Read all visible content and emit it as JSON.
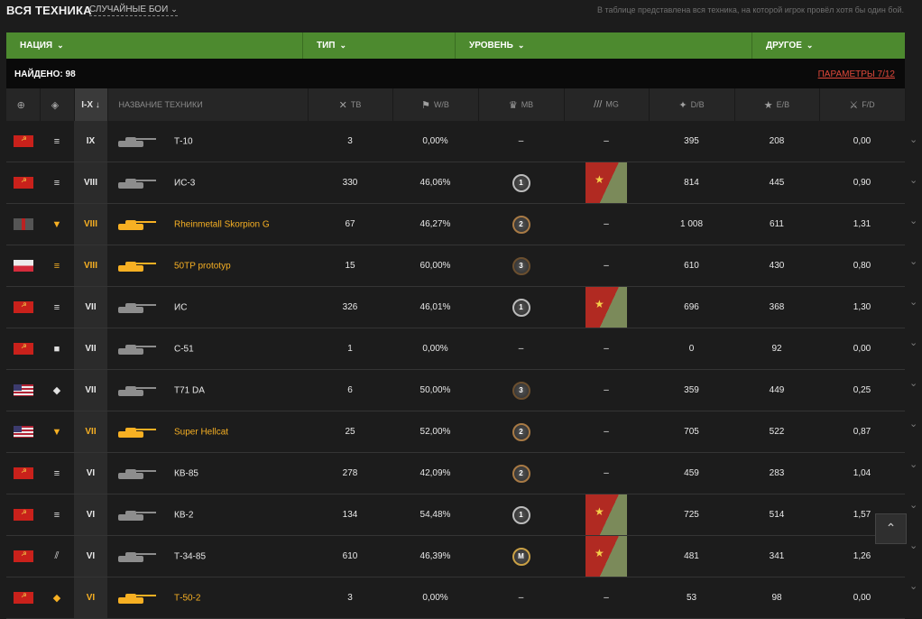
{
  "header": {
    "title": "ВСЯ ТЕХНИКА",
    "mode": "СЛУЧАЙНЫЕ БОИ",
    "note": "В таблице представлена вся техника, на которой игрок провёл хотя бы один бой."
  },
  "filters": {
    "nation": "НАЦИЯ",
    "type": "ТИП",
    "level": "УРОВЕНЬ",
    "other": "ДРУГОЕ"
  },
  "found": "НАЙДЕНО: 98",
  "params": "ПАРАМЕТРЫ 7/12",
  "columns": {
    "tier": "I-X ↓",
    "name": "НАЗВАНИЕ ТЕХНИКИ",
    "battles": "ТВ",
    "winrate": "W/B",
    "mastery": "MB",
    "marks": "MG",
    "damage": "D/B",
    "exp": "E/B",
    "frags": "F/D"
  },
  "rows": [
    {
      "flag": "ussr",
      "type": "heavy",
      "premium": false,
      "tier": "IX",
      "name": "Т-10",
      "battles": "3",
      "winrate": "0,00%",
      "mastery": "–",
      "marks": "–",
      "damage": "395",
      "exp": "208",
      "frags": "0,00"
    },
    {
      "flag": "ussr",
      "type": "heavy",
      "premium": false,
      "tier": "VIII",
      "name": "ИС-3",
      "battles": "330",
      "winrate": "46,06%",
      "mastery": "1",
      "marks": "flag",
      "damage": "814",
      "exp": "445",
      "frags": "0,90"
    },
    {
      "flag": "germany",
      "type": "td",
      "premium": true,
      "tier": "VIII",
      "name": "Rheinmetall Skorpion G",
      "battles": "67",
      "winrate": "46,27%",
      "mastery": "2",
      "marks": "–",
      "damage": "1 008",
      "exp": "611",
      "frags": "1,31"
    },
    {
      "flag": "poland",
      "type": "heavy",
      "premium": true,
      "tier": "VIII",
      "name": "50TP prototyp",
      "battles": "15",
      "winrate": "60,00%",
      "mastery": "3",
      "marks": "–",
      "damage": "610",
      "exp": "430",
      "frags": "0,80"
    },
    {
      "flag": "ussr",
      "type": "heavy",
      "premium": false,
      "tier": "VII",
      "name": "ИС",
      "battles": "326",
      "winrate": "46,01%",
      "mastery": "1",
      "marks": "flag",
      "damage": "696",
      "exp": "368",
      "frags": "1,30"
    },
    {
      "flag": "ussr",
      "type": "spg",
      "premium": false,
      "tier": "VII",
      "name": "С-51",
      "battles": "1",
      "winrate": "0,00%",
      "mastery": "–",
      "marks": "–",
      "damage": "0",
      "exp": "92",
      "frags": "0,00"
    },
    {
      "flag": "usa",
      "type": "light",
      "premium": false,
      "tier": "VII",
      "name": "T71 DA",
      "battles": "6",
      "winrate": "50,00%",
      "mastery": "3",
      "marks": "–",
      "damage": "359",
      "exp": "449",
      "frags": "0,25"
    },
    {
      "flag": "usa",
      "type": "td",
      "premium": true,
      "tier": "VII",
      "name": "Super Hellcat",
      "battles": "25",
      "winrate": "52,00%",
      "mastery": "2",
      "marks": "–",
      "damage": "705",
      "exp": "522",
      "frags": "0,87"
    },
    {
      "flag": "ussr",
      "type": "heavy",
      "premium": false,
      "tier": "VI",
      "name": "КВ-85",
      "battles": "278",
      "winrate": "42,09%",
      "mastery": "2",
      "marks": "–",
      "damage": "459",
      "exp": "283",
      "frags": "1,04"
    },
    {
      "flag": "ussr",
      "type": "heavy",
      "premium": false,
      "tier": "VI",
      "name": "КВ-2",
      "battles": "134",
      "winrate": "54,48%",
      "mastery": "1",
      "marks": "flag",
      "damage": "725",
      "exp": "514",
      "frags": "1,57"
    },
    {
      "flag": "ussr",
      "type": "medium",
      "premium": false,
      "tier": "VI",
      "name": "Т-34-85",
      "battles": "610",
      "winrate": "46,39%",
      "mastery": "M",
      "marks": "flag",
      "damage": "481",
      "exp": "341",
      "frags": "1,26"
    },
    {
      "flag": "ussr",
      "type": "light",
      "premium": true,
      "tier": "VI",
      "name": "Т-50-2",
      "battles": "3",
      "winrate": "0,00%",
      "mastery": "–",
      "marks": "–",
      "damage": "53",
      "exp": "98",
      "frags": "0,00"
    }
  ],
  "icons": {
    "type_heavy": "≡",
    "type_medium": "⫽",
    "type_td": "▼",
    "type_spg": "■",
    "type_light": "◆"
  }
}
